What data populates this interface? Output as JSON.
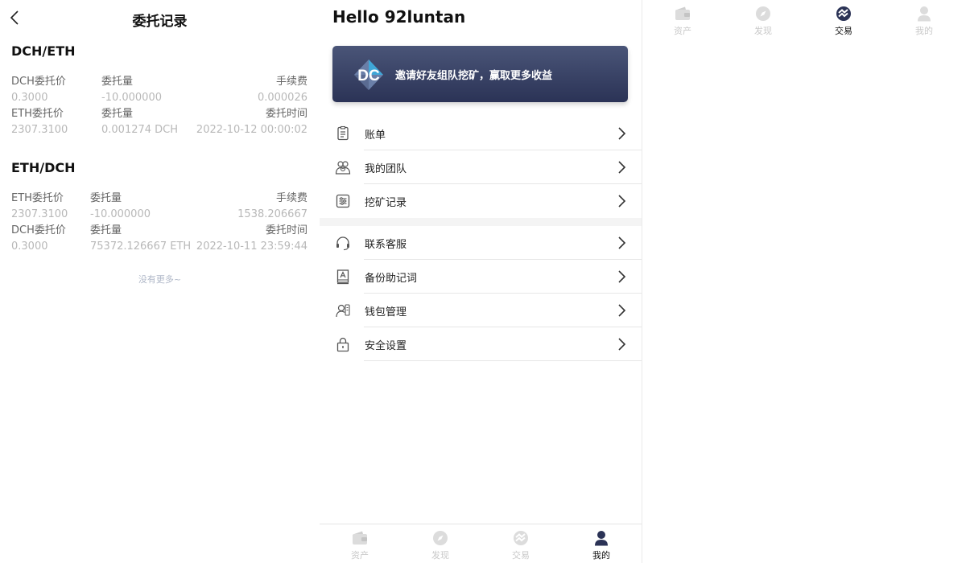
{
  "orders_page": {
    "title": "委托记录",
    "orders": [
      {
        "pair": "DCH/ETH",
        "row1_labels": [
          "DCH委托价",
          "委托量",
          "手续费"
        ],
        "row1_values": [
          "0.3000",
          "-10.000000",
          "0.000026"
        ],
        "row2_labels": [
          "ETH委托价",
          "委托量",
          "委托时间"
        ],
        "row2_values": [
          "2307.3100",
          "0.001274 DCH",
          "2022-10-12 00:00:02"
        ]
      },
      {
        "pair": "ETH/DCH",
        "row1_labels": [
          "ETH委托价",
          "委托量",
          "手续费"
        ],
        "row1_values": [
          "2307.3100",
          "-10.000000",
          "1538.206667"
        ],
        "row2_labels": [
          "DCH委托价",
          "委托量",
          "委托时间"
        ],
        "row2_values": [
          "0.3000",
          "75372.126667 ETH",
          "2022-10-11 23:59:44"
        ]
      }
    ],
    "no_more": "没有更多~"
  },
  "profile_page": {
    "greeting": "Hello 92luntan",
    "banner": {
      "logo_text": "DC",
      "text": "邀请好友组队挖矿，赢取更多收益"
    },
    "menu_group_1": [
      {
        "label": "账单",
        "icon": "bill-icon"
      },
      {
        "label": "我的团队",
        "icon": "team-icon"
      },
      {
        "label": "挖矿记录",
        "icon": "mining-record-icon"
      }
    ],
    "menu_group_2": [
      {
        "label": "联系客服",
        "icon": "headset-icon"
      },
      {
        "label": "备份助记词",
        "icon": "backup-book-icon"
      },
      {
        "label": "钱包管理",
        "icon": "wallet-manage-icon"
      },
      {
        "label": "安全设置",
        "icon": "lock-icon"
      }
    ]
  },
  "tabbar": {
    "items": [
      "资产",
      "发现",
      "交易",
      "我的"
    ]
  },
  "colors": {
    "accent_dark": "#2b3356",
    "tab_inactive": "#c9c9c9",
    "value_gray": "#b8b8b8"
  }
}
